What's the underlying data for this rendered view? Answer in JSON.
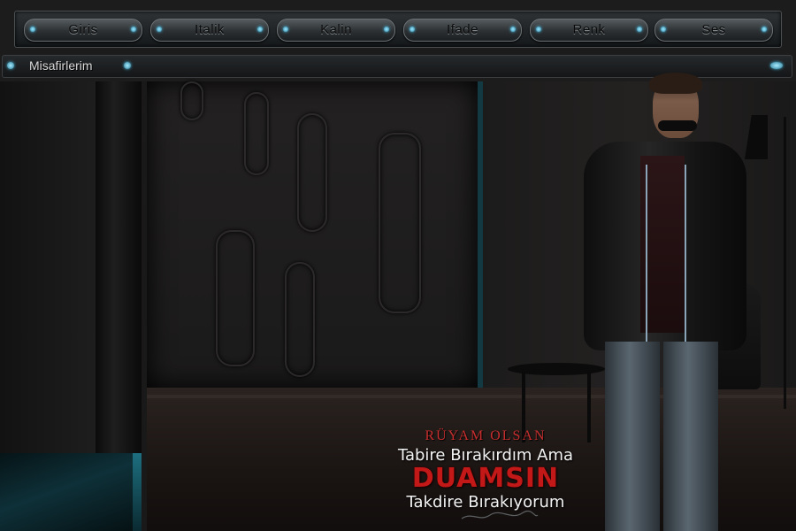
{
  "toolbar": {
    "buttons": [
      {
        "label": "Giris"
      },
      {
        "label": "Italik"
      },
      {
        "label": "Kalin"
      },
      {
        "label": "Ifade"
      },
      {
        "label": "Renk"
      },
      {
        "label": "Ses"
      }
    ]
  },
  "guests": {
    "label": "Misafirlerim"
  },
  "poem": {
    "line1": "RÜYAM OLSAN",
    "line2": "Tabire Bırakırdım Ama",
    "line3": "DUAMSIN",
    "line4": "Takdire Bırakıyorum"
  },
  "colors": {
    "accent_teal": "#46c0e8",
    "poem_red": "#c21818",
    "toolbar_bg": "#1c1c1c"
  }
}
